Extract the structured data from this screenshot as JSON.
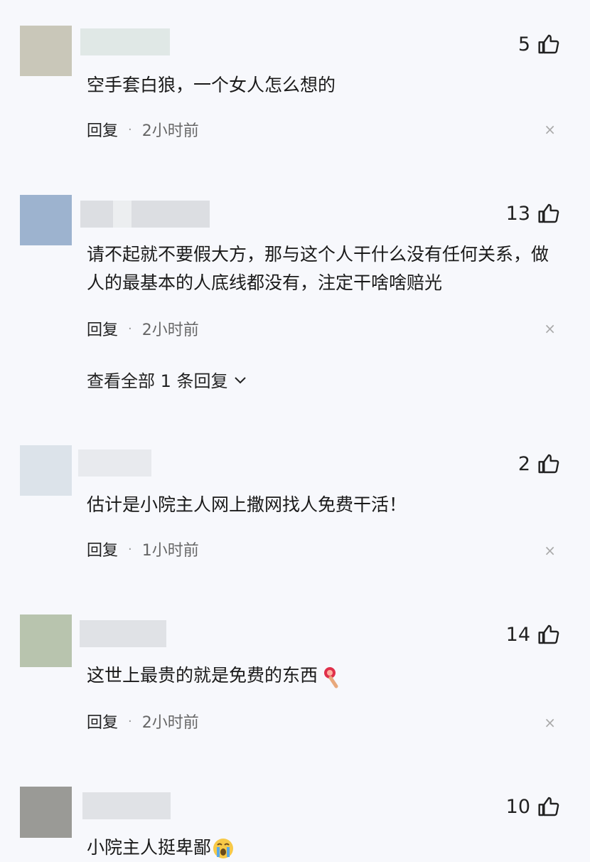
{
  "comments": [
    {
      "avatar_color": "#c9c7b9",
      "likes": "5",
      "text": "空手套白狼，一个女人怎么想的",
      "reply_label": "回复",
      "time": "2小时前"
    },
    {
      "avatar_color": "#9db3cf",
      "likes": "13",
      "text": "请不起就不要假大方，那与这个人干什么没有任何关系，做人的最基本的人底线都没有，注定干啥啥赔光",
      "reply_label": "回复",
      "time": "2小时前",
      "view_all": "查看全部 1 条回复"
    },
    {
      "avatar_color": "#dce3ea",
      "likes": "2",
      "text": "估计是小院主人网上撒网找人免费干活！",
      "reply_label": "回复",
      "time": "1小时前"
    },
    {
      "avatar_color": "#b8c4ae",
      "likes": "14",
      "text": "这世上最贵的就是免费的东西",
      "emoji": "rose-emoji",
      "reply_label": "回复",
      "time": "2小时前"
    },
    {
      "avatar_color": "#9a9a96",
      "likes": "10",
      "text": "小院主人挺卑鄙",
      "emoji": "crying-emoji"
    }
  ],
  "icons": {
    "like": "thumbs-up-icon",
    "close": "close-icon",
    "chevron": "chevron-down-icon"
  },
  "close_symbol": "×"
}
